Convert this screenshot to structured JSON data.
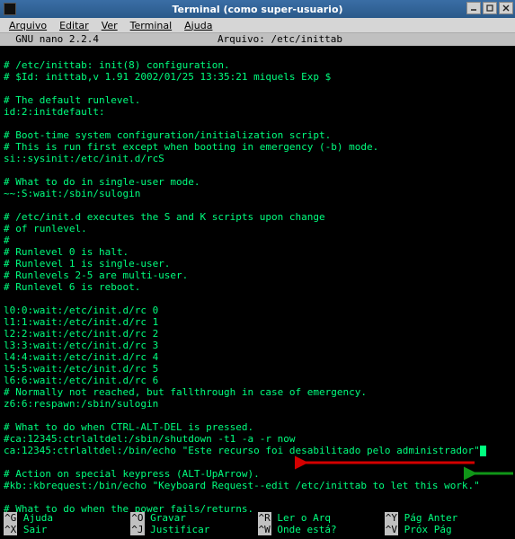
{
  "window": {
    "title": "Terminal (como super-usuario)"
  },
  "menu": {
    "items": [
      "Arquivo",
      "Editar",
      "Ver",
      "Terminal",
      "Ajuda"
    ]
  },
  "nano": {
    "version_label": "  GNU nano 2.2.4",
    "file_label": "Arquivo: /etc/inittab"
  },
  "file": {
    "lines": [
      "",
      "# /etc/inittab: init(8) configuration.",
      "# $Id: inittab,v 1.91 2002/01/25 13:35:21 miquels Exp $",
      "",
      "# The default runlevel.",
      "id:2:initdefault:",
      "",
      "# Boot-time system configuration/initialization script.",
      "# This is run first except when booting in emergency (-b) mode.",
      "si::sysinit:/etc/init.d/rcS",
      "",
      "# What to do in single-user mode.",
      "~~:S:wait:/sbin/sulogin",
      "",
      "# /etc/init.d executes the S and K scripts upon change",
      "# of runlevel.",
      "#",
      "# Runlevel 0 is halt.",
      "# Runlevel 1 is single-user.",
      "# Runlevels 2-5 are multi-user.",
      "# Runlevel 6 is reboot.",
      "",
      "l0:0:wait:/etc/init.d/rc 0",
      "l1:1:wait:/etc/init.d/rc 1",
      "l2:2:wait:/etc/init.d/rc 2",
      "l3:3:wait:/etc/init.d/rc 3",
      "l4:4:wait:/etc/init.d/rc 4",
      "l5:5:wait:/etc/init.d/rc 5",
      "l6:6:wait:/etc/init.d/rc 6",
      "# Normally not reached, but fallthrough in case of emergency.",
      "z6:6:respawn:/sbin/sulogin",
      "",
      "# What to do when CTRL-ALT-DEL is pressed.",
      "#ca:12345:ctrlaltdel:/sbin/shutdown -t1 -a -r now",
      "ca:12345:ctrlaltdel:/bin/echo \"Este recurso foi desabilitado pelo administrador\"",
      "",
      "# Action on special keypress (ALT-UpArrow).",
      "#kb::kbrequest:/bin/echo \"Keyboard Request--edit /etc/inittab to let this work.\"",
      "",
      "# What to do when the power fails/returns."
    ]
  },
  "shortcuts": {
    "row1": [
      {
        "key": "^G",
        "label": " Ajuda"
      },
      {
        "key": "^O",
        "label": " Gravar"
      },
      {
        "key": "^R",
        "label": " Ler o Arq"
      },
      {
        "key": "^Y",
        "label": " Pág Anter"
      }
    ],
    "row2": [
      {
        "key": "^X",
        "label": " Sair"
      },
      {
        "key": "^J",
        "label": " Justificar"
      },
      {
        "key": "^W",
        "label": " Onde está?"
      },
      {
        "key": "^V",
        "label": " Próx Pág"
      }
    ]
  },
  "cursor": {
    "line_index": 34
  }
}
